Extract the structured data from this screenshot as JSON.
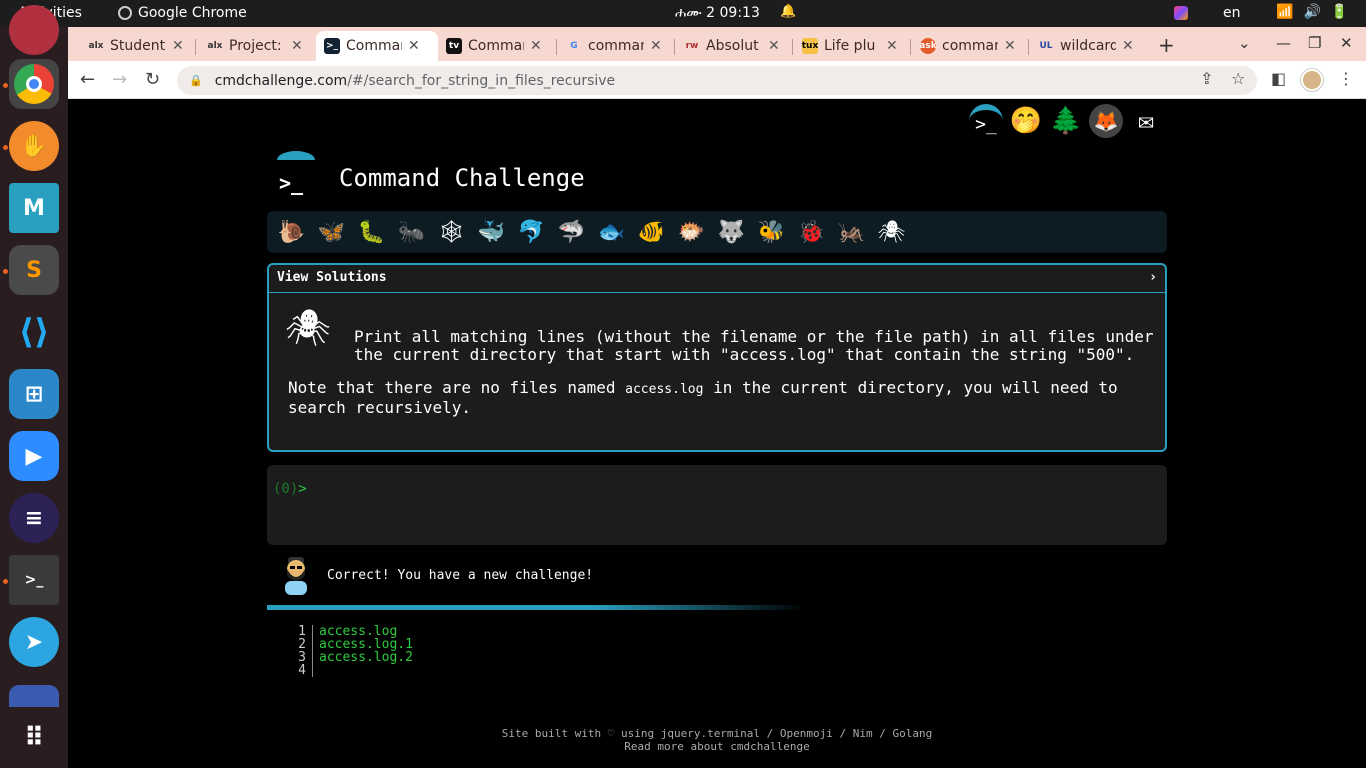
{
  "system_bar": {
    "activities": "Activities",
    "app_name": "Google Chrome",
    "clock": "ሐሙ 2  09:13",
    "lang": "en"
  },
  "dock": {
    "items": [
      "ubuntu-software",
      "chrome",
      "flameshot",
      "mail",
      "sublime-text",
      "vscode",
      "remote-desktop",
      "zoom",
      "eclipse",
      "terminal",
      "telegram",
      "app-drawer-peek",
      "show-apps"
    ]
  },
  "browser": {
    "tabs": [
      {
        "label": "Student",
        "favicon": "alx"
      },
      {
        "label": "Project:",
        "favicon": "alx"
      },
      {
        "label": "Comman",
        "favicon": ">_",
        "active": true
      },
      {
        "label": "Comman",
        "favicon": "tv"
      },
      {
        "label": "comman",
        "favicon": "G"
      },
      {
        "label": "Absolut",
        "favicon": "rw"
      },
      {
        "label": "Life plu",
        "favicon": "tux"
      },
      {
        "label": "comman",
        "favicon": "ask"
      },
      {
        "label": "wildcard",
        "favicon": "UL"
      }
    ],
    "url_host": "cmdchallenge.com",
    "url_path": "/#/search_for_string_in_files_recursive"
  },
  "page": {
    "title": "Command Challenge",
    "solutions_label": "View Solutions",
    "solutions_chevron": "›",
    "task": "Print all matching lines (without the filename or the file path) in all files under the current directory that start with \"access.log\" that contain the string \"500\".",
    "note_prefix": "Note that there are no files named ",
    "note_code": "access.log",
    "note_suffix": " in the current directory, you will need to search recursively.",
    "prompt_code": "(0)",
    "prompt_symbol": ">",
    "message": "Correct! You have a new challenge!",
    "output": [
      {
        "num": "1",
        "text": "access.log"
      },
      {
        "num": "2",
        "text": "access.log.1"
      },
      {
        "num": "3",
        "text": "access.log.2"
      },
      {
        "num": "4",
        "text": ""
      }
    ],
    "footer_line1": "Site built with ♡ using jquery.terminal / Openmoji / Nim / Golang",
    "footer_line2": "Read more about cmdchallenge"
  }
}
